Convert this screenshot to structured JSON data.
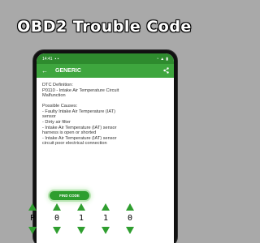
{
  "banner": {
    "title": "OBD2 Trouble Code"
  },
  "statusbar": {
    "time": "14:41"
  },
  "appbar": {
    "title": "GENERIC"
  },
  "content": {
    "definition_label": "DTC Definition:",
    "definition_lines": [
      "P0110 - Intake Air Temperature Circuit",
      "Malfunction"
    ],
    "causes_label": "Possible Causes:",
    "causes_lines": [
      "- Faulty Intake Air Temperature (IAT)",
      "sensor",
      "- Dirty air filter",
      "- Intake Air Temperature (IAT) sensor",
      "harness is open or shorted",
      "- Intake Air Temperature (IAT) sensor",
      "circuit poor electrical connection"
    ]
  },
  "find_button": {
    "label": "FIND CODE"
  },
  "code": {
    "digits": [
      "P",
      "0",
      "1",
      "1",
      "0"
    ]
  },
  "colors": {
    "primary": "#3ea63e",
    "primary_dark": "#2e8b2e",
    "background": "#a9a9a9"
  },
  "icons": {
    "back": "arrow-back-icon",
    "share": "share-icon",
    "up": "triangle-up-icon",
    "down": "triangle-down-icon"
  }
}
